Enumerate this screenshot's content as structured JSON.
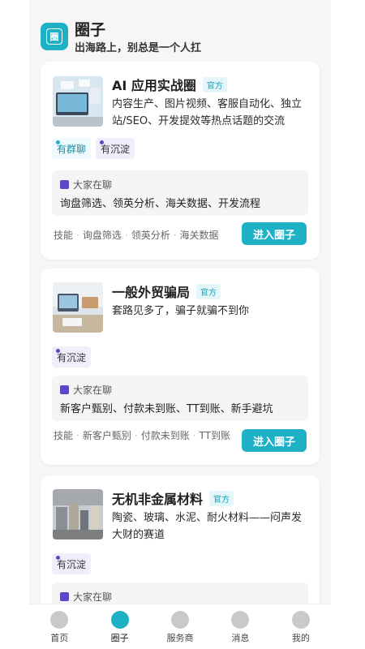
{
  "header": {
    "logo_char": "圈",
    "title": "圈子",
    "subtitle": "出海路上，别总是一个人扛"
  },
  "cards": [
    {
      "name": "AI 应用实战圈",
      "badge": "官方",
      "desc": "内容生产、图片视频、客服自动化、独立站/SEO、开发提效等热点话题的交流",
      "tags": [
        "有群聊",
        "有沉淀"
      ],
      "chat_head": "大家在聊",
      "chat_text": "询盘筛选、领英分析、海关数据、开发流程",
      "keywords": [
        "技能",
        "询盘筛选",
        "领英分析",
        "海关数据"
      ],
      "join": "进入圈子"
    },
    {
      "name": "一般外贸骗局",
      "badge": "官方",
      "desc": "套路见多了，骗子就骗不到你",
      "tags": [
        "有沉淀"
      ],
      "chat_head": "大家在聊",
      "chat_text": "新客户甄别、付款未到账、TT到账、新手避坑",
      "keywords": [
        "技能",
        "新客户甄别",
        "付款未到账",
        "TT到账"
      ],
      "join": "进入圈子"
    },
    {
      "name": "无机非金属材料",
      "badge": "官方",
      "desc": "陶瓷、玻璃、水泥、耐火材料——闷声发大财的赛道",
      "tags": [
        "有沉淀"
      ],
      "chat_head": "大家在聊"
    }
  ],
  "tabbar": [
    {
      "label": "首页",
      "icon": "home-icon"
    },
    {
      "label": "圈子",
      "icon": "circle-icon",
      "active": true
    },
    {
      "label": "服务商",
      "icon": "service-icon"
    },
    {
      "label": "消息",
      "icon": "message-icon"
    },
    {
      "label": "我的",
      "icon": "profile-icon"
    }
  ],
  "colors": {
    "accent": "#1eb1c6",
    "purple": "#5a48c6"
  }
}
